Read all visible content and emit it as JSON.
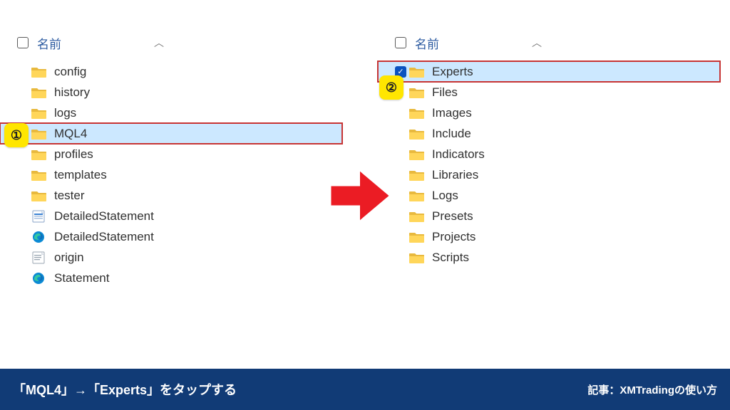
{
  "header": {
    "name_label": "名前"
  },
  "callouts": {
    "one": "①",
    "two": "②"
  },
  "left": {
    "items": [
      {
        "label": "config",
        "icon": "folder"
      },
      {
        "label": "history",
        "icon": "folder"
      },
      {
        "label": "logs",
        "icon": "folder"
      },
      {
        "label": "MQL4",
        "icon": "folder",
        "selected": true
      },
      {
        "label": "profiles",
        "icon": "folder"
      },
      {
        "label": "templates",
        "icon": "folder"
      },
      {
        "label": "tester",
        "icon": "folder"
      },
      {
        "label": "DetailedStatement",
        "icon": "html"
      },
      {
        "label": "DetailedStatement",
        "icon": "edge"
      },
      {
        "label": "origin",
        "icon": "txt"
      },
      {
        "label": "Statement",
        "icon": "edge"
      }
    ]
  },
  "right": {
    "items": [
      {
        "label": "Experts",
        "icon": "folder",
        "selected": true
      },
      {
        "label": "Files",
        "icon": "folder"
      },
      {
        "label": "Images",
        "icon": "folder"
      },
      {
        "label": "Include",
        "icon": "folder"
      },
      {
        "label": "Indicators",
        "icon": "folder"
      },
      {
        "label": "Libraries",
        "icon": "folder"
      },
      {
        "label": "Logs",
        "icon": "folder"
      },
      {
        "label": "Presets",
        "icon": "folder"
      },
      {
        "label": "Projects",
        "icon": "folder"
      },
      {
        "label": "Scripts",
        "icon": "folder"
      }
    ]
  },
  "footer": {
    "instruction": "「MQL4」→「Experts」をタップする",
    "credit": "記事：XMTradingの使い方"
  },
  "colors": {
    "highlight": "#cce8ff",
    "callout": "#ffe600",
    "footer_bg": "#113b76",
    "arrow": "#eb1c24"
  }
}
